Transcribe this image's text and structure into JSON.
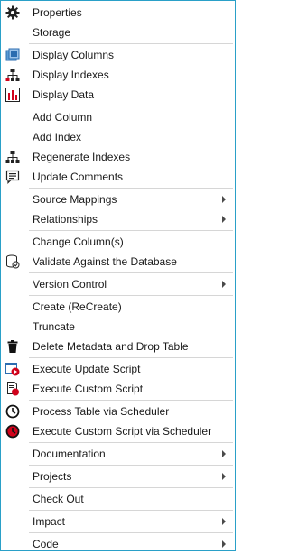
{
  "menu": {
    "items": [
      {
        "label": "Properties",
        "icon": "gear-icon"
      },
      {
        "label": "Storage",
        "icon": ""
      },
      {
        "label": "Display Columns",
        "icon": "columns-icon"
      },
      {
        "label": "Display Indexes",
        "icon": "index-tree-icon"
      },
      {
        "label": "Display Data",
        "icon": "bar-chart-icon"
      },
      {
        "label": "Add Column",
        "icon": ""
      },
      {
        "label": "Add Index",
        "icon": ""
      },
      {
        "label": "Regenerate Indexes",
        "icon": "index-tree-icon"
      },
      {
        "label": "Update Comments",
        "icon": "comment-icon"
      },
      {
        "label": "Source Mappings",
        "icon": "",
        "submenu": true
      },
      {
        "label": "Relationships",
        "icon": "",
        "submenu": true
      },
      {
        "label": "Change Column(s)",
        "icon": ""
      },
      {
        "label": "Validate Against the Database",
        "icon": "database-check-icon"
      },
      {
        "label": "Version Control",
        "icon": "",
        "submenu": true
      },
      {
        "label": "Create (ReCreate)",
        "icon": ""
      },
      {
        "label": "Truncate",
        "icon": ""
      },
      {
        "label": "Delete Metadata and Drop Table",
        "icon": "trash-icon"
      },
      {
        "label": "Execute Update Script",
        "icon": "execute-update-script-icon"
      },
      {
        "label": "Execute Custom Script",
        "icon": "execute-custom-script-icon"
      },
      {
        "label": "Process Table via Scheduler",
        "icon": "clock-icon"
      },
      {
        "label": "Execute Custom Script via Scheduler",
        "icon": "clock-red-icon"
      },
      {
        "label": "Documentation",
        "icon": "",
        "submenu": true
      },
      {
        "label": "Projects",
        "icon": "",
        "submenu": true
      },
      {
        "label": "Check Out",
        "icon": ""
      },
      {
        "label": "Impact",
        "icon": "",
        "submenu": true
      },
      {
        "label": "Code",
        "icon": "",
        "submenu": true
      }
    ]
  },
  "colors": {
    "border": "#2aa0c8",
    "separator": "#d6d6d6",
    "text": "#1a1a1a",
    "icon_red": "#d0021b",
    "icon_blue": "#2b6cb0"
  }
}
